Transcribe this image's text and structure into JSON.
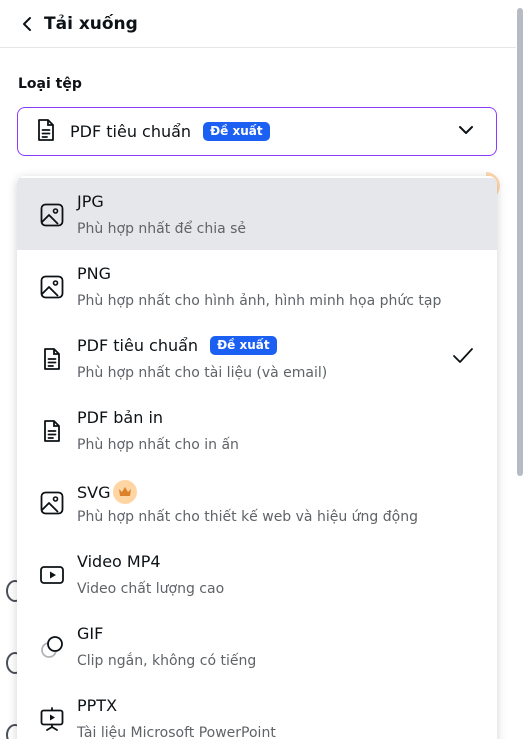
{
  "header": {
    "title": "Tải xuống",
    "back_icon": "chevron-left-icon"
  },
  "file_type": {
    "label": "Loại tệp",
    "selected": "PDF tiêu chuẩn",
    "selected_badge": "Đề xuất"
  },
  "colors": {
    "accent": "#8b3dff",
    "badge": "#1b5ff3",
    "hover": "#e6e7ea",
    "crown_bg": "#ffd6a3"
  },
  "options": [
    {
      "name": "JPG",
      "desc": "Phù hợp nhất để chia sẻ",
      "icon": "image-icon",
      "hovered": true
    },
    {
      "name": "PNG",
      "desc": "Phù hợp nhất cho hình ảnh, hình minh họa phức tạp",
      "icon": "image-icon"
    },
    {
      "name": "PDF tiêu chuẩn",
      "badge": "Đề xuất",
      "desc": "Phù hợp nhất cho tài liệu (và email)",
      "icon": "document-icon",
      "selected": true
    },
    {
      "name": "PDF bản in",
      "desc": "Phù hợp nhất cho in ấn",
      "icon": "document-icon"
    },
    {
      "name": "SVG",
      "desc": "Phù hợp nhất cho thiết kế web và hiệu ứng động",
      "icon": "image-icon",
      "premium": true
    },
    {
      "name": "Video MP4",
      "desc": "Video chất lượng cao",
      "icon": "video-icon"
    },
    {
      "name": "GIF",
      "desc": "Clip ngắn, không có tiếng",
      "icon": "gif-icon"
    },
    {
      "name": "PPTX",
      "desc": "Tài liệu Microsoft PowerPoint",
      "icon": "presentation-icon"
    }
  ]
}
